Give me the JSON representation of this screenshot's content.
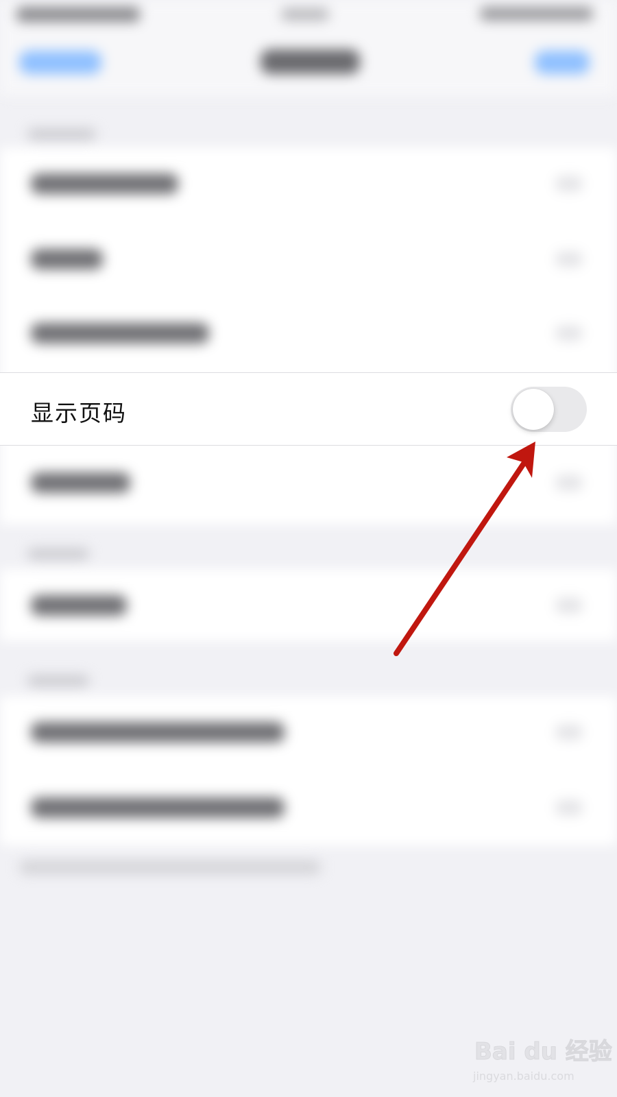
{
  "setting_row": {
    "label": "显示页码",
    "toggle_on": false
  },
  "colors": {
    "background": "#f1f1f5",
    "row_background": "#ffffff",
    "toggle_off_track": "#e9e9eb",
    "annotation_arrow": "#c0170f",
    "link_blue": "#8fc0ff"
  },
  "watermark": {
    "logo_text": "Bai du 经验",
    "url": "jingyan.baidu.com"
  },
  "icons": [
    "annotation-arrow-icon",
    "baidu-paw-icon"
  ]
}
